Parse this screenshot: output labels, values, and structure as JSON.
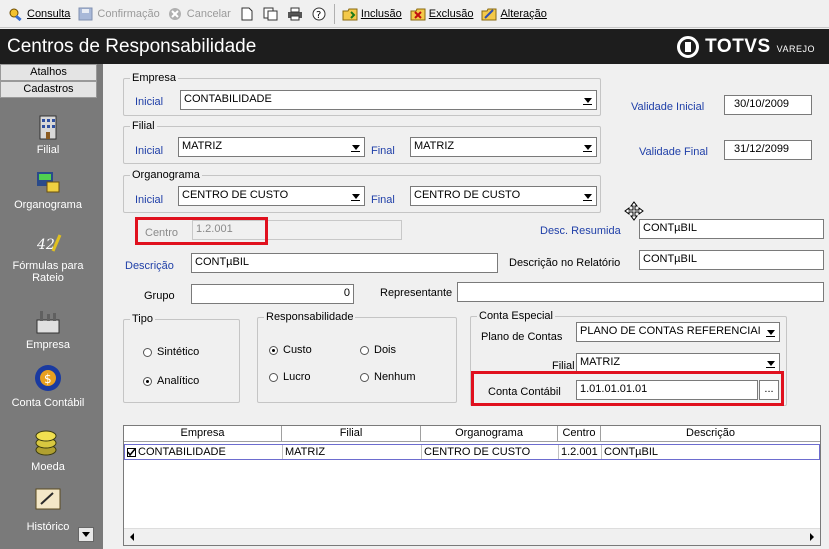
{
  "toolbar": {
    "consulta": "Consulta",
    "confirmacao": "Confirmação",
    "cancelar": "Cancelar",
    "inclusao": "Inclusão",
    "exclusao": "Exclusão",
    "alteracao": "Alteração"
  },
  "window": {
    "title": "Centros de Responsabilidade",
    "logo_main": "TOTVS",
    "logo_sub": "VAREJO"
  },
  "sidebar": {
    "tab_atalhos": "Atalhos",
    "tab_cadastros": "Cadastros",
    "items": [
      {
        "label": "Filial",
        "icon": "building-icon"
      },
      {
        "label": "Organograma",
        "icon": "organogram-icon"
      },
      {
        "label": "Fórmulas para Rateio",
        "icon": "formula-icon"
      },
      {
        "label": "Empresa",
        "icon": "factory-icon"
      },
      {
        "label": "Conta Contábil",
        "icon": "money-bag-icon"
      },
      {
        "label": "Moeda",
        "icon": "coins-icon"
      },
      {
        "label": "Histórico",
        "icon": "history-icon"
      }
    ]
  },
  "empresa": {
    "group": "Empresa",
    "inicial_label": "Inicial",
    "inicial_value": "CONTABILIDADE"
  },
  "filial": {
    "group": "Filial",
    "inicial_label": "Inicial",
    "inicial_value": "MATRIZ",
    "final_label": "Final",
    "final_value": "MATRIZ"
  },
  "organograma": {
    "group": "Organograma",
    "inicial_label": "Inicial",
    "inicial_value": "CENTRO DE CUSTO",
    "final_label": "Final",
    "final_value": "CENTRO DE CUSTO"
  },
  "validade": {
    "inicial_label": "Validade Inicial",
    "inicial_value": "30/10/2009",
    "final_label": "Validade Final",
    "final_value": "31/12/2099"
  },
  "centro": {
    "label": "Centro",
    "value": "1.2.001"
  },
  "desc_resumida": {
    "label": "Desc. Resumida",
    "value": "CONTµBIL"
  },
  "descricao": {
    "label": "Descrição",
    "value": "CONTµBIL"
  },
  "descricao_relatorio": {
    "label": "Descrição no Relatório",
    "value": "CONTµBIL"
  },
  "grupo": {
    "label": "Grupo",
    "value": "0"
  },
  "representante": {
    "label": "Representante",
    "value": ""
  },
  "tipo": {
    "group": "Tipo",
    "options": [
      "Sintético",
      "Analítico"
    ],
    "selected": "Analítico"
  },
  "responsabilidade": {
    "group": "Responsabilidade",
    "options": [
      "Custo",
      "Dois",
      "Lucro",
      "Nenhum"
    ],
    "selected": "Custo"
  },
  "conta_especial": {
    "group": "Conta Especial",
    "plano_label": "Plano de Contas",
    "plano_value": "PLANO DE CONTAS REFERENCIAI",
    "filial_label": "Filial",
    "filial_value": "MATRIZ",
    "conta_label": "Conta Contábil",
    "conta_value": "1.01.01.01.01",
    "browse_label": "..."
  },
  "grid": {
    "columns": [
      "Empresa",
      "Filial",
      "Organograma",
      "Centro",
      "Descrição"
    ],
    "rows": [
      {
        "checked": true,
        "empresa": "CONTABILIDADE",
        "filial": "MATRIZ",
        "organograma": "CENTRO DE CUSTO",
        "centro": "1.2.001",
        "descricao": "CONTµBIL"
      }
    ]
  }
}
